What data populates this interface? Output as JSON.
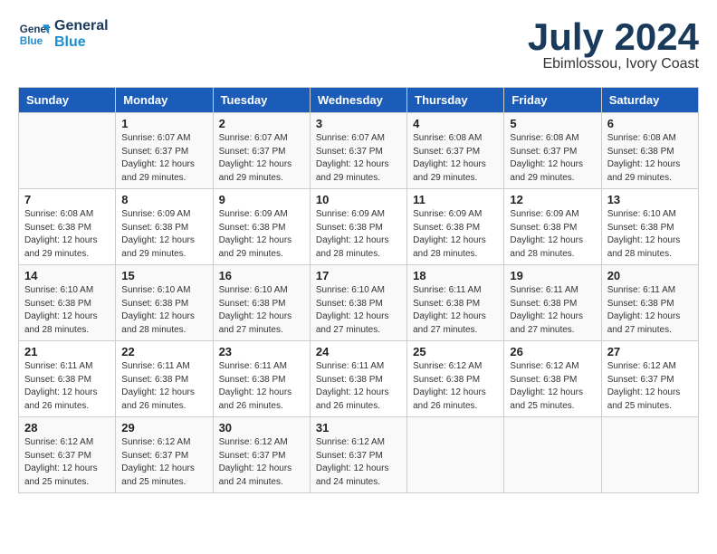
{
  "header": {
    "logo_line1": "General",
    "logo_line2": "Blue",
    "month": "July 2024",
    "location": "Ebimlossou, Ivory Coast"
  },
  "weekdays": [
    "Sunday",
    "Monday",
    "Tuesday",
    "Wednesday",
    "Thursday",
    "Friday",
    "Saturday"
  ],
  "weeks": [
    [
      {
        "day": "",
        "info": ""
      },
      {
        "day": "1",
        "info": "Sunrise: 6:07 AM\nSunset: 6:37 PM\nDaylight: 12 hours\nand 29 minutes."
      },
      {
        "day": "2",
        "info": "Sunrise: 6:07 AM\nSunset: 6:37 PM\nDaylight: 12 hours\nand 29 minutes."
      },
      {
        "day": "3",
        "info": "Sunrise: 6:07 AM\nSunset: 6:37 PM\nDaylight: 12 hours\nand 29 minutes."
      },
      {
        "day": "4",
        "info": "Sunrise: 6:08 AM\nSunset: 6:37 PM\nDaylight: 12 hours\nand 29 minutes."
      },
      {
        "day": "5",
        "info": "Sunrise: 6:08 AM\nSunset: 6:37 PM\nDaylight: 12 hours\nand 29 minutes."
      },
      {
        "day": "6",
        "info": "Sunrise: 6:08 AM\nSunset: 6:38 PM\nDaylight: 12 hours\nand 29 minutes."
      }
    ],
    [
      {
        "day": "7",
        "info": "Sunrise: 6:08 AM\nSunset: 6:38 PM\nDaylight: 12 hours\nand 29 minutes."
      },
      {
        "day": "8",
        "info": "Sunrise: 6:09 AM\nSunset: 6:38 PM\nDaylight: 12 hours\nand 29 minutes."
      },
      {
        "day": "9",
        "info": "Sunrise: 6:09 AM\nSunset: 6:38 PM\nDaylight: 12 hours\nand 29 minutes."
      },
      {
        "day": "10",
        "info": "Sunrise: 6:09 AM\nSunset: 6:38 PM\nDaylight: 12 hours\nand 28 minutes."
      },
      {
        "day": "11",
        "info": "Sunrise: 6:09 AM\nSunset: 6:38 PM\nDaylight: 12 hours\nand 28 minutes."
      },
      {
        "day": "12",
        "info": "Sunrise: 6:09 AM\nSunset: 6:38 PM\nDaylight: 12 hours\nand 28 minutes."
      },
      {
        "day": "13",
        "info": "Sunrise: 6:10 AM\nSunset: 6:38 PM\nDaylight: 12 hours\nand 28 minutes."
      }
    ],
    [
      {
        "day": "14",
        "info": "Sunrise: 6:10 AM\nSunset: 6:38 PM\nDaylight: 12 hours\nand 28 minutes."
      },
      {
        "day": "15",
        "info": "Sunrise: 6:10 AM\nSunset: 6:38 PM\nDaylight: 12 hours\nand 28 minutes."
      },
      {
        "day": "16",
        "info": "Sunrise: 6:10 AM\nSunset: 6:38 PM\nDaylight: 12 hours\nand 27 minutes."
      },
      {
        "day": "17",
        "info": "Sunrise: 6:10 AM\nSunset: 6:38 PM\nDaylight: 12 hours\nand 27 minutes."
      },
      {
        "day": "18",
        "info": "Sunrise: 6:11 AM\nSunset: 6:38 PM\nDaylight: 12 hours\nand 27 minutes."
      },
      {
        "day": "19",
        "info": "Sunrise: 6:11 AM\nSunset: 6:38 PM\nDaylight: 12 hours\nand 27 minutes."
      },
      {
        "day": "20",
        "info": "Sunrise: 6:11 AM\nSunset: 6:38 PM\nDaylight: 12 hours\nand 27 minutes."
      }
    ],
    [
      {
        "day": "21",
        "info": "Sunrise: 6:11 AM\nSunset: 6:38 PM\nDaylight: 12 hours\nand 26 minutes."
      },
      {
        "day": "22",
        "info": "Sunrise: 6:11 AM\nSunset: 6:38 PM\nDaylight: 12 hours\nand 26 minutes."
      },
      {
        "day": "23",
        "info": "Sunrise: 6:11 AM\nSunset: 6:38 PM\nDaylight: 12 hours\nand 26 minutes."
      },
      {
        "day": "24",
        "info": "Sunrise: 6:11 AM\nSunset: 6:38 PM\nDaylight: 12 hours\nand 26 minutes."
      },
      {
        "day": "25",
        "info": "Sunrise: 6:12 AM\nSunset: 6:38 PM\nDaylight: 12 hours\nand 26 minutes."
      },
      {
        "day": "26",
        "info": "Sunrise: 6:12 AM\nSunset: 6:38 PM\nDaylight: 12 hours\nand 25 minutes."
      },
      {
        "day": "27",
        "info": "Sunrise: 6:12 AM\nSunset: 6:37 PM\nDaylight: 12 hours\nand 25 minutes."
      }
    ],
    [
      {
        "day": "28",
        "info": "Sunrise: 6:12 AM\nSunset: 6:37 PM\nDaylight: 12 hours\nand 25 minutes."
      },
      {
        "day": "29",
        "info": "Sunrise: 6:12 AM\nSunset: 6:37 PM\nDaylight: 12 hours\nand 25 minutes."
      },
      {
        "day": "30",
        "info": "Sunrise: 6:12 AM\nSunset: 6:37 PM\nDaylight: 12 hours\nand 24 minutes."
      },
      {
        "day": "31",
        "info": "Sunrise: 6:12 AM\nSunset: 6:37 PM\nDaylight: 12 hours\nand 24 minutes."
      },
      {
        "day": "",
        "info": ""
      },
      {
        "day": "",
        "info": ""
      },
      {
        "day": "",
        "info": ""
      }
    ]
  ]
}
